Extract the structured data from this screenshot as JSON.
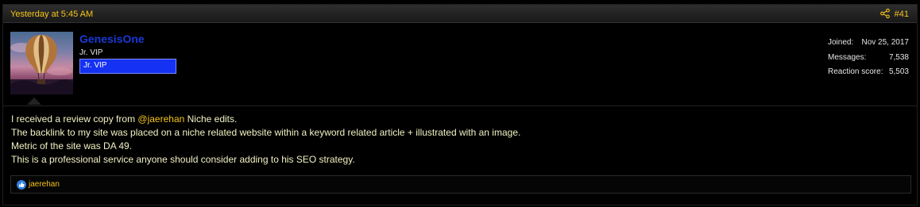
{
  "post": {
    "date": "Yesterday at 5:45 AM",
    "number": "#41",
    "share_icon": "share-icon"
  },
  "user": {
    "name": "GenesisOne",
    "title": "Jr. VIP",
    "banner": "Jr. VIP",
    "avatar_icon": "hot-air-balloon-avatar",
    "stats": [
      {
        "label": "Joined:",
        "value": "Nov 25, 2017"
      },
      {
        "label": "Messages:",
        "value": "7,538"
      },
      {
        "label": "Reaction score:",
        "value": "5,503"
      }
    ]
  },
  "message": {
    "line1_before": "I received a review copy from ",
    "line1_mention": "@jaerehan",
    "line1_after": " Niche edits.",
    "line2": "The backlink to my site was placed on a niche related website within a keyword related article + illustrated with an image.",
    "line3": "Metric of the site was DA 49.",
    "line4": "This is a professional service anyone should consider adding to his SEO strategy."
  },
  "reactions": {
    "icon": "thumbs-up-icon",
    "user": "jaerehan"
  },
  "colors": {
    "accent": "#f5c518",
    "username": "#1b39d6",
    "banner_bg": "#1531f2",
    "body_text": "#f2f2c4"
  }
}
